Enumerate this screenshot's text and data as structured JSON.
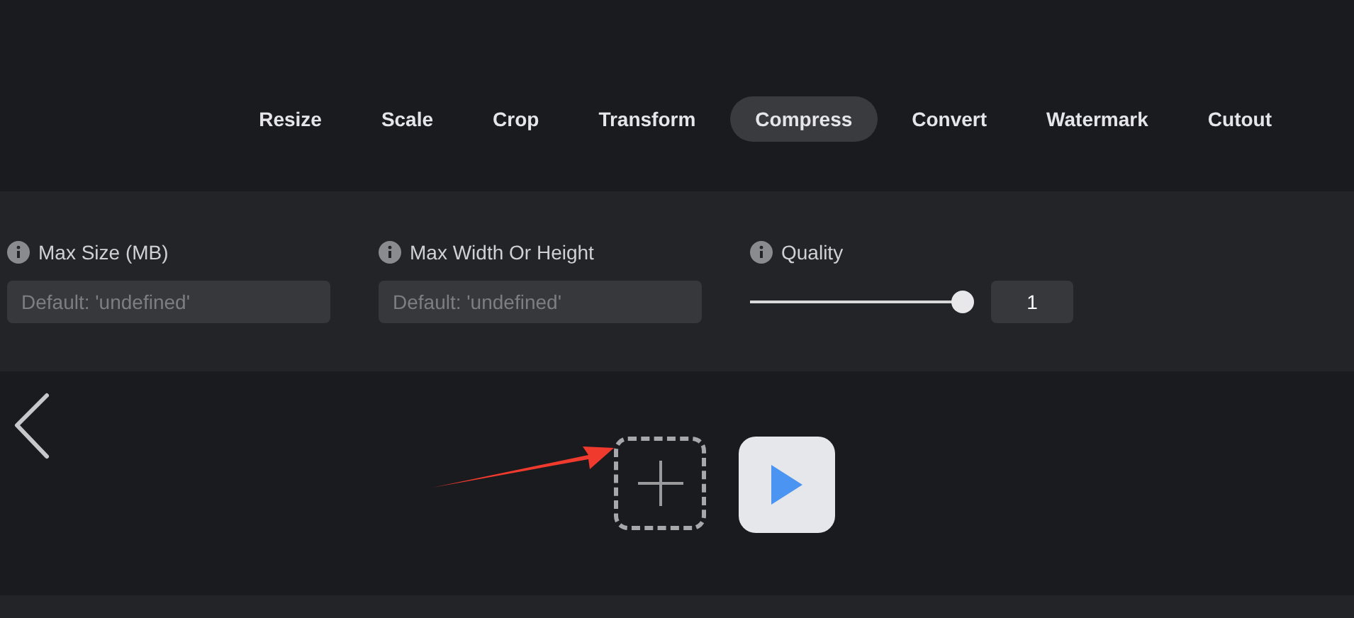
{
  "tabs": [
    {
      "label": "Resize",
      "selected": false
    },
    {
      "label": "Scale",
      "selected": false
    },
    {
      "label": "Crop",
      "selected": false
    },
    {
      "label": "Transform",
      "selected": false
    },
    {
      "label": "Compress",
      "selected": true
    },
    {
      "label": "Convert",
      "selected": false
    },
    {
      "label": "Watermark",
      "selected": false
    },
    {
      "label": "Cutout",
      "selected": false
    }
  ],
  "options": [
    {
      "kind": "field",
      "label": "Max Size (MB)",
      "placeholder": "Default: 'undefined'"
    },
    {
      "kind": "field",
      "label": "Max Width Or Height",
      "placeholder": "Default: 'undefined'"
    },
    {
      "kind": "slider",
      "label": "Quality",
      "level": 1,
      "value": "1"
    }
  ]
}
